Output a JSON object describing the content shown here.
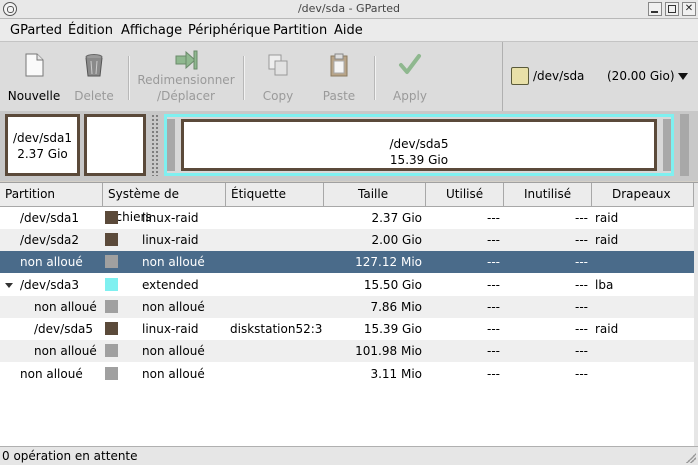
{
  "window": {
    "title": "/dev/sda - GParted"
  },
  "menu": [
    "GParted",
    "Édition",
    "Affichage",
    "Périphérique",
    "Partition",
    "Aide"
  ],
  "toolbar": {
    "new": "Nouvelle",
    "delete": "Delete",
    "resize_line1": "Redimensionner",
    "resize_line2": "/Déplacer",
    "copy": "Copy",
    "paste": "Paste",
    "apply": "Apply"
  },
  "device": {
    "name": "/dev/sda",
    "size": "(20.00 Gio)"
  },
  "diskmap": {
    "sda1_name": "/dev/sda1",
    "sda1_size": "2.37 Gio",
    "sda5_name": "/dev/sda5",
    "sda5_size": "15.39 Gio"
  },
  "columns": [
    "Partition",
    "Système de fichiers",
    "Étiquette",
    "Taille",
    "Utilisé",
    "Inutilisé",
    "Drapeaux"
  ],
  "rows": [
    {
      "partition": "/dev/sda1",
      "fs": "linux-raid",
      "label": "",
      "size": "2.37 Gio",
      "used": "---",
      "unused": "---",
      "flags": "raid"
    },
    {
      "partition": "/dev/sda2",
      "fs": "linux-raid",
      "label": "",
      "size": "2.00 Gio",
      "used": "---",
      "unused": "---",
      "flags": "raid"
    },
    {
      "partition": "non alloué",
      "fs": "non alloué",
      "label": "",
      "size": "127.12 Mio",
      "used": "---",
      "unused": "---",
      "flags": ""
    },
    {
      "partition": "/dev/sda3",
      "fs": "extended",
      "label": "",
      "size": "15.50 Gio",
      "used": "---",
      "unused": "---",
      "flags": "lba"
    },
    {
      "partition": "non alloué",
      "fs": "non alloué",
      "label": "",
      "size": "7.86 Mio",
      "used": "---",
      "unused": "---",
      "flags": ""
    },
    {
      "partition": "/dev/sda5",
      "fs": "linux-raid",
      "label": "diskstation52:3",
      "size": "15.39 Gio",
      "used": "---",
      "unused": "---",
      "flags": "raid"
    },
    {
      "partition": "non alloué",
      "fs": "non alloué",
      "label": "",
      "size": "101.98 Mio",
      "used": "---",
      "unused": "---",
      "flags": ""
    },
    {
      "partition": "non alloué",
      "fs": "non alloué",
      "label": "",
      "size": "3.11 Mio",
      "used": "---",
      "unused": "---",
      "flags": ""
    }
  ],
  "colors": {
    "linux_raid": "#5b4a3a",
    "unallocated": "#a0a0a0",
    "extended": "#7ff0f0",
    "selection": "#4a6b8a"
  },
  "status": "0 opération en attente"
}
